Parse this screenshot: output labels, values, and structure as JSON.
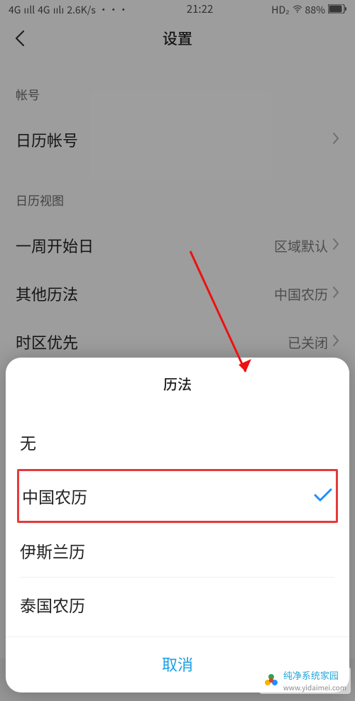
{
  "statusbar": {
    "left1": "4G",
    "signal1": "ııll",
    "left2": "4G",
    "signal2": "ıılı",
    "speed": "2.6K/s",
    "dots": "···",
    "time": "21:22",
    "hd": "HD₂",
    "battery_pct": "88%"
  },
  "nav": {
    "title": "设置"
  },
  "sections": {
    "account": {
      "header": "帐号",
      "calendar_account": "日历帐号"
    },
    "view": {
      "header": "日历视图",
      "week_start": {
        "label": "一周开始日",
        "value": "区域默认"
      },
      "other_cal": {
        "label": "其他历法",
        "value": "中国农历"
      },
      "tz_priority": {
        "label": "时区优先",
        "value": "已关闭"
      }
    }
  },
  "sheet": {
    "title": "历法",
    "options": [
      "无",
      "中国农历",
      "伊斯兰历",
      "泰国农历"
    ],
    "selected_index": 1,
    "cancel": "取消"
  },
  "watermark": {
    "brand": "纯净系统家园",
    "url": "www.yidaimei.com"
  }
}
